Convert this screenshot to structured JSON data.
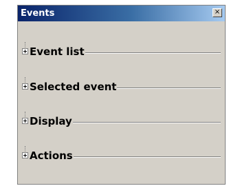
{
  "window": {
    "title": "Events",
    "close_label": "×"
  },
  "sections": [
    {
      "label": "Event list",
      "expanded": false
    },
    {
      "label": "Selected event",
      "expanded": false
    },
    {
      "label": "Display",
      "expanded": false
    },
    {
      "label": "Actions",
      "expanded": false
    }
  ]
}
